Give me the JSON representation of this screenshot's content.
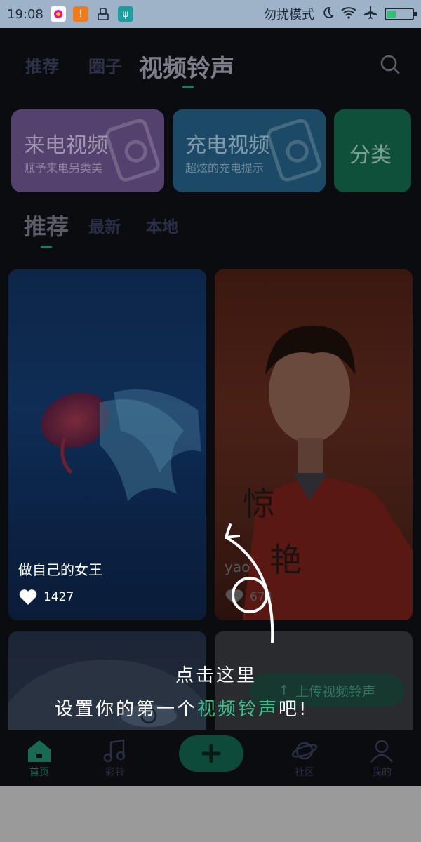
{
  "status_bar": {
    "time": "19:08",
    "dnd_text": "勿扰模式",
    "battery_level": 0.35
  },
  "top_nav": {
    "tabs": [
      {
        "label": "推荐"
      },
      {
        "label": "圈子"
      },
      {
        "label": "视频铃声"
      }
    ],
    "active_tab": "视频铃声"
  },
  "banners": [
    {
      "title": "来电视频",
      "subtitle": "赋予来电另类美",
      "color": "#54416e"
    },
    {
      "title": "充电视频",
      "subtitle": "超炫的充电提示",
      "color": "#1c4a66"
    },
    {
      "title": "分类",
      "color": "#0e5039"
    }
  ],
  "sub_tabs": [
    {
      "label": "推荐"
    },
    {
      "label": "最新"
    },
    {
      "label": "本地"
    }
  ],
  "cards": [
    {
      "title": "做自己的女王",
      "likes": "1427"
    },
    {
      "title": "yao",
      "likes": "674"
    }
  ],
  "upload_button": {
    "label": "上传视频铃声"
  },
  "guide": {
    "line1": "点击这里",
    "line2_prefix": "设置你的第一个",
    "line2_highlight": "视频铃声",
    "line2_suffix": "吧!"
  },
  "bottom_nav": {
    "items": [
      {
        "label": "首页"
      },
      {
        "label": "彩铃"
      },
      {
        "label": "社区"
      },
      {
        "label": "我的"
      }
    ]
  },
  "colors": {
    "accent": "#35c88e",
    "background": "#0b0c10"
  }
}
